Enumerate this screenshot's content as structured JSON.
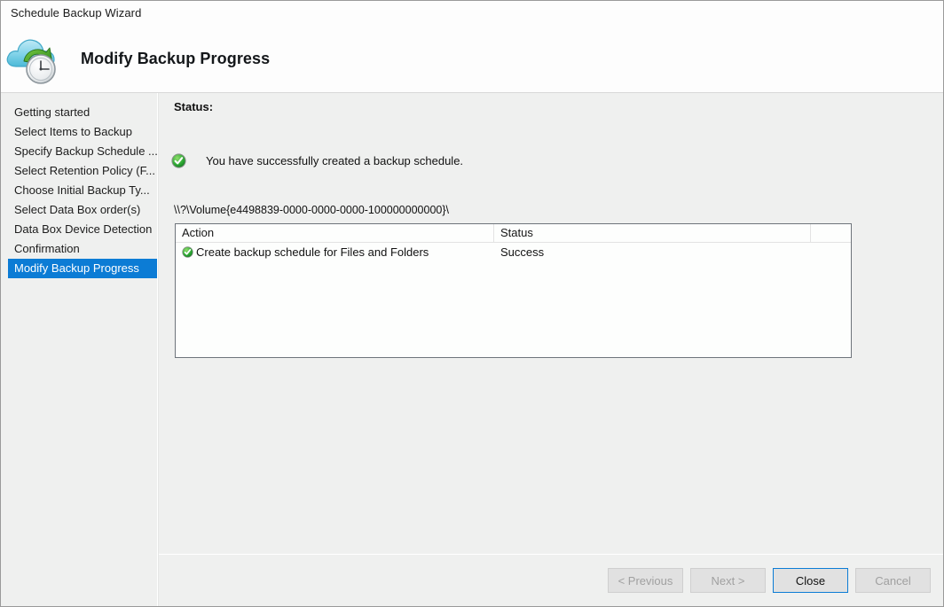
{
  "window": {
    "title": "Schedule Backup Wizard"
  },
  "banner": {
    "title": "Modify Backup Progress",
    "icon": "cloud-backup-clock-icon"
  },
  "sidebar": {
    "items": [
      {
        "label": "Getting started",
        "selected": false
      },
      {
        "label": "Select Items to Backup",
        "selected": false
      },
      {
        "label": "Specify Backup Schedule ...",
        "selected": false
      },
      {
        "label": "Select Retention Policy (F...",
        "selected": false
      },
      {
        "label": "Choose Initial Backup Ty...",
        "selected": false
      },
      {
        "label": "Select Data Box order(s)",
        "selected": false
      },
      {
        "label": "Data Box Device Detection",
        "selected": false
      },
      {
        "label": "Confirmation",
        "selected": false
      },
      {
        "label": "Modify Backup Progress",
        "selected": true
      }
    ]
  },
  "main": {
    "status_label": "Status:",
    "success_message": "You have successfully created a backup schedule.",
    "success_icon": "green-check-circle-icon",
    "volume_path": "\\\\?\\Volume{e4498839-0000-0000-0000-100000000000}\\",
    "table": {
      "columns": [
        "Action",
        "Status",
        ""
      ],
      "rows": [
        {
          "icon": "green-check-circle-icon",
          "action": "Create backup schedule for Files and Folders",
          "status": "Success",
          "extra": ""
        }
      ]
    }
  },
  "footer": {
    "buttons": [
      {
        "label": "< Previous",
        "enabled": false,
        "name": "previous-button"
      },
      {
        "label": "Next >",
        "enabled": false,
        "name": "next-button"
      },
      {
        "label": "Close",
        "enabled": true,
        "name": "close-button"
      },
      {
        "label": "Cancel",
        "enabled": false,
        "name": "cancel-button"
      }
    ]
  },
  "colors": {
    "accent": "#0c7cd5",
    "success": "#1f9d2f",
    "window_bg": "#eff0ef",
    "panel_bg": "#fdfefd"
  }
}
